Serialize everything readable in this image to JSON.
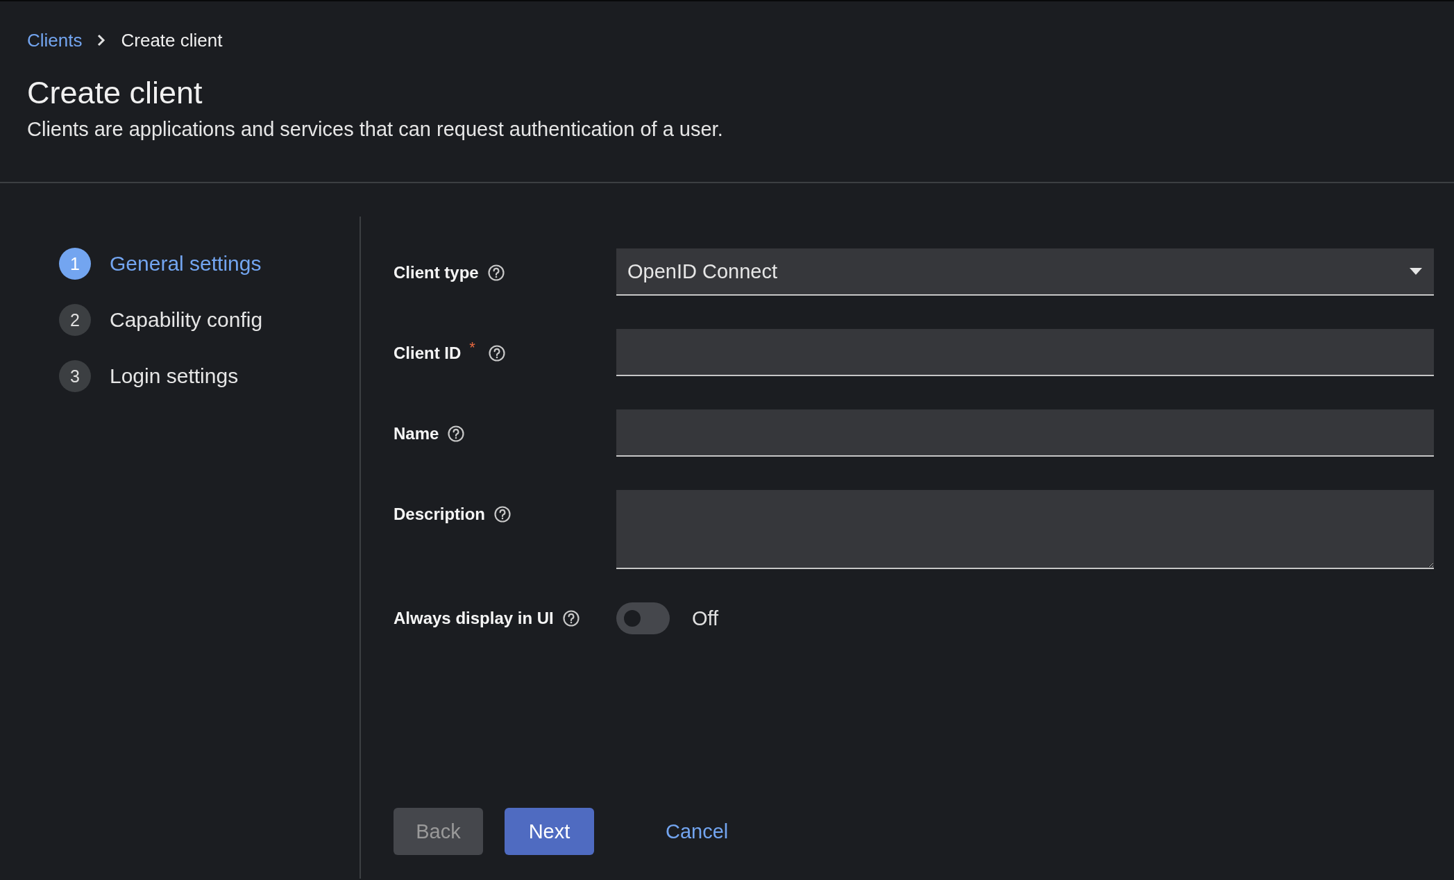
{
  "breadcrumb": [
    {
      "label": "Clients",
      "kind": "link"
    },
    {
      "label": "Create client",
      "kind": "current"
    }
  ],
  "page": {
    "title": "Create client",
    "description": "Clients are applications and services that can request authentication of a user."
  },
  "steps": [
    {
      "number": "1",
      "label": "General settings",
      "selected": true
    },
    {
      "number": "2",
      "label": "Capability config",
      "selected": false
    },
    {
      "number": "3",
      "label": "Login settings",
      "selected": false
    }
  ],
  "form": {
    "fields": [
      {
        "label": "Client type",
        "kind": "select",
        "value": "OpenID Connect"
      },
      {
        "label": "Client ID",
        "kind": "text",
        "required_mark": "*"
      },
      {
        "label": "Name",
        "kind": "text"
      },
      {
        "label": "Description",
        "kind": "textarea"
      },
      {
        "label": "Always display in UI",
        "kind": "toggle",
        "on": false,
        "state_text": "Off"
      }
    ]
  },
  "actions": [
    {
      "label": "Back",
      "kind": "secondary",
      "disabled": true
    },
    {
      "label": "Next",
      "kind": "primary",
      "disabled": false
    },
    {
      "label": "Cancel",
      "kind": "link",
      "disabled": false
    }
  ]
}
